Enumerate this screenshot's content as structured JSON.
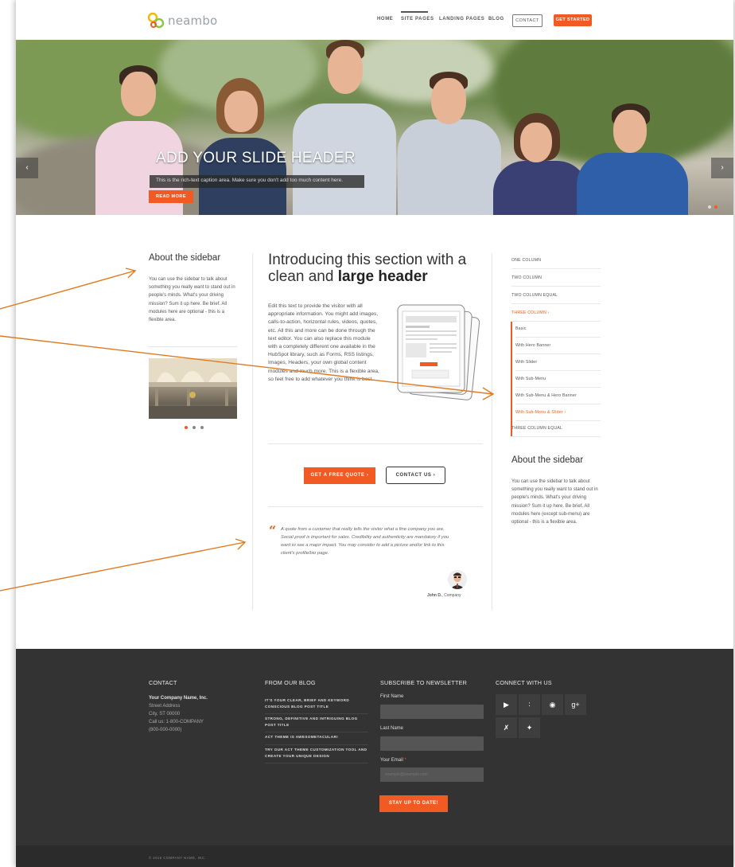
{
  "brand": {
    "logo_text": "neambo",
    "accent": "#f15a22"
  },
  "nav": {
    "home": "HOME",
    "site_pages": "SITE PAGES",
    "landing_pages": "LANDING PAGES",
    "blog": "BLOG",
    "contact": "CONTACT",
    "get_started": "GET STARTED"
  },
  "hero": {
    "slide_header": "ADD YOUR SLIDE HEADER",
    "caption": "This is the rich-text caption area. Make sure you don't add too much content here.",
    "read_more": "READ MORE",
    "prev_icon": "chevron-left-icon",
    "next_icon": "chevron-right-icon"
  },
  "left_sidebar": {
    "title": "About the sidebar",
    "text": "You can use the sidebar to talk about something you really want to stand out in people's minds. What's your driving mission? Sum it up here. Be brief. All modules here are optional - this is a flexible area."
  },
  "main": {
    "heading_plain": "Introducing this section with a clean and ",
    "heading_bold": "large header",
    "body": "Edit this text to provide the visitor with all appropriate information. You might add images, calls-to-action, horizontal rules, videos, quotes, etc. All this and more can be done through the text editor. You can also replace this module with a completely different one available in the HubSpot library, such as Forms, RSS listings, Images, Headers, your own global content modules and much more. This is a flexible area, so feel free to add whatever you think is best.",
    "quote_button": "GET A FREE QUOTE ›",
    "contact_button": "CONTACT US ›",
    "testimonial": "A quote from a customer that really tells the visitor what a fine company you are.  Social proof is important for sales. Credibility and authenticity are mandatory if you want to see a major impact. You may consider to add a picture and/or link to this client's profile/bio page.",
    "author_name": "John D.",
    "author_company": ", Company"
  },
  "right_sidebar": {
    "menu": [
      "ONE COLUMN",
      "TWO COLUMN",
      "TWO COLUMN EQUAL",
      "THREE COLUMN  ›"
    ],
    "submenu": [
      "Basic",
      "With Hero Banner",
      "With Slider",
      "With Sub-Menu",
      "With Sub-Menu & Hero Banner",
      "With Sub-Menu & Slider  ›"
    ],
    "after": "THREE COLUMN EQUAL",
    "title": "About the sidebar",
    "text": "You can use the sidebar to talk about something you really want to stand out in people's minds. What's your driving mission? Sum it up here. Be brief. All modules here (except sub-menu) are optional - this is a flexible area."
  },
  "footer": {
    "contact": {
      "title": "CONTACT",
      "company": "Your Company Name, Inc.",
      "address": "Street Address",
      "city": "City, ST 00000",
      "call": "Call us: 1-800-COMPANY",
      "phone": "(800-000-0000)"
    },
    "blog": {
      "title": "FROM OUR BLOG",
      "posts": [
        "IT'S YOUR CLEAR, BRIEF AND KEYWORD CONSCIOUS BLOG POST TITLE",
        "STRONG, DEFINITIVE AND INTRIGUING BLOG POST TITLE",
        "ACT THEME IS AWESOMETACULAR!",
        "TRY OUR ACT THEME CUSTOMIZATION TOOL AND CREATE YOUR UNIQUE DESIGN"
      ]
    },
    "newsletter": {
      "title": "SUBSCRIBE TO NEWSLETTER",
      "first_name": "First Name",
      "last_name": "Last Name",
      "email": "Your Email",
      "required": "*",
      "email_placeholder": "example@example.com",
      "button": "STAY UP TO DATE!"
    },
    "connect": {
      "title": "CONNECT WITH US",
      "icons": [
        "youtube-icon",
        "rss-icon",
        "pinterest-icon",
        "google-plus-icon",
        "xing-icon",
        "twitter-icon"
      ]
    },
    "copyright": "© 2015 COMPANY NAME, INC."
  }
}
